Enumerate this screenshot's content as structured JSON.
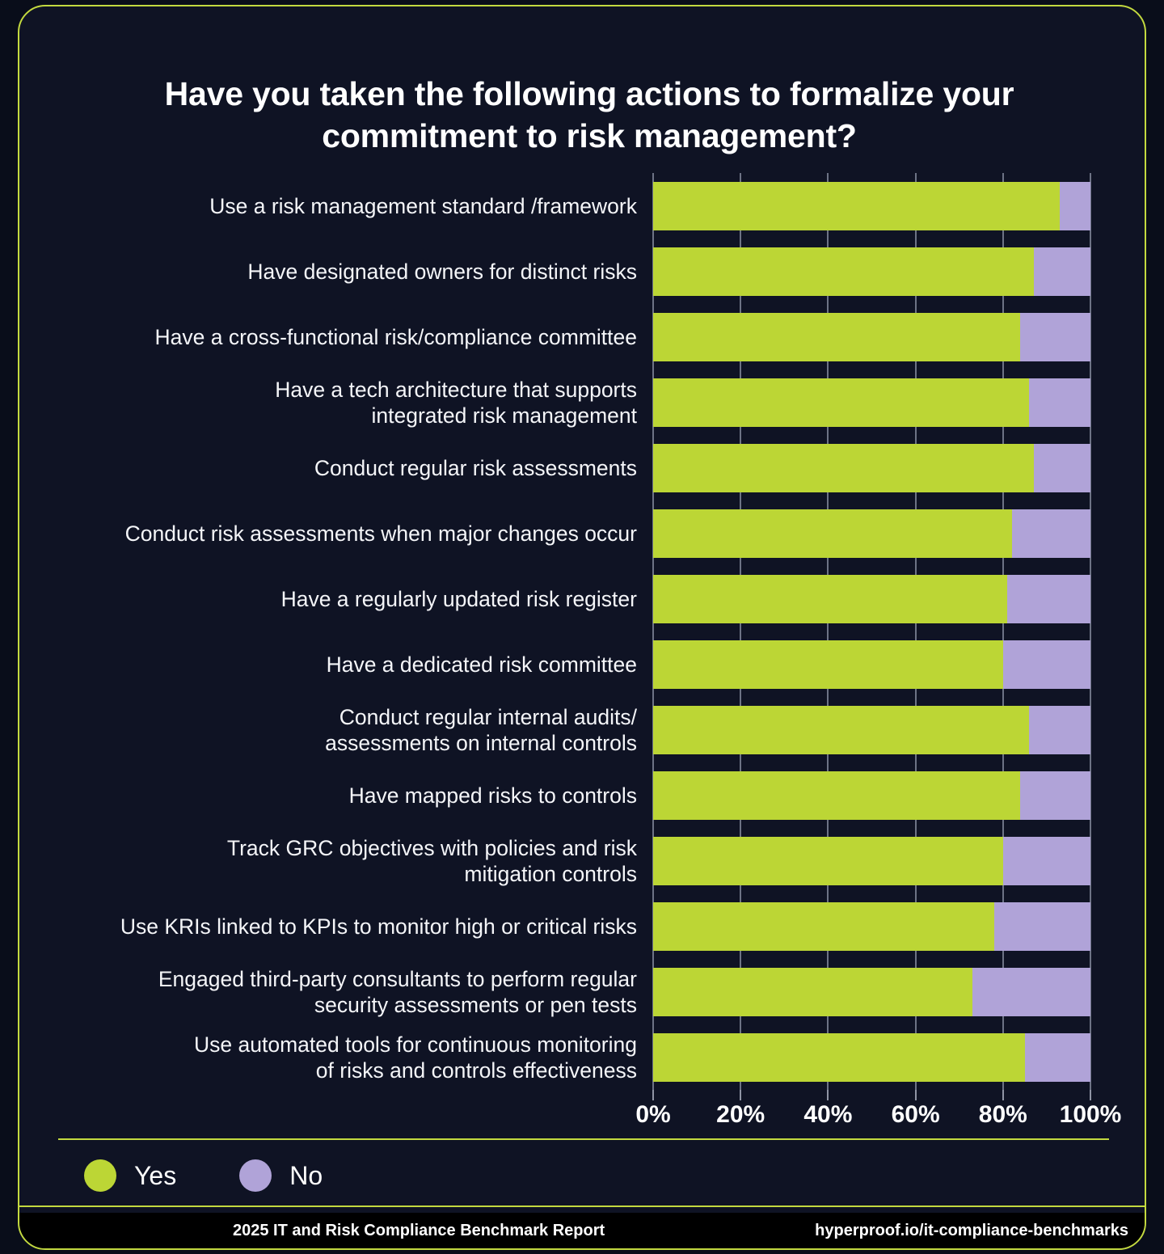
{
  "card": {
    "accent_color": "#c3d93f",
    "background_color": "#0f1324"
  },
  "title": "Have you taken the following actions to formalize your commitment to risk management?",
  "legend": {
    "items": [
      {
        "label": "Yes",
        "color": "#bcd635"
      },
      {
        "label": "No",
        "color": "#b0a3d8"
      }
    ]
  },
  "footer": {
    "left": "2025 IT and Risk Compliance Benchmark Report",
    "right": "hyperproof.io/it-compliance-benchmarks"
  },
  "chart_data": {
    "type": "bar",
    "orientation": "horizontal",
    "stacked": true,
    "title": "Have you taken the following actions to formalize your commitment to risk management?",
    "xlabel": "",
    "ylabel": "",
    "xlim": [
      0,
      100
    ],
    "xticks": [
      0,
      20,
      40,
      60,
      80,
      100
    ],
    "xtick_labels": [
      "0%",
      "20%",
      "40%",
      "60%",
      "80%",
      "100%"
    ],
    "grid": true,
    "legend_position": "bottom-left",
    "categories": [
      "Use a risk management standard /framework",
      "Have designated owners for distinct risks",
      "Have a cross-functional risk/compliance committee",
      "Have a tech architecture that supports\nintegrated risk management",
      "Conduct regular risk assessments",
      "Conduct risk assessments when major changes occur",
      "Have a regularly updated risk register",
      "Have a dedicated risk committee",
      "Conduct regular internal audits/\nassessments on internal controls",
      "Have mapped risks to controls",
      "Track GRC objectives with policies and risk\nmitigation controls",
      "Use KRIs linked to KPIs to monitor high or critical risks",
      "Engaged third-party consultants to perform regular\nsecurity assessments or pen tests",
      "Use automated tools for continuous monitoring\nof risks and controls effectiveness"
    ],
    "series": [
      {
        "name": "Yes",
        "color": "#bcd635",
        "values": [
          93,
          87,
          84,
          86,
          87,
          82,
          81,
          80,
          86,
          84,
          80,
          78,
          73,
          85
        ]
      },
      {
        "name": "No",
        "color": "#b0a3d8",
        "values": [
          7,
          13,
          16,
          14,
          13,
          18,
          19,
          20,
          14,
          16,
          20,
          22,
          27,
          15
        ]
      }
    ]
  }
}
